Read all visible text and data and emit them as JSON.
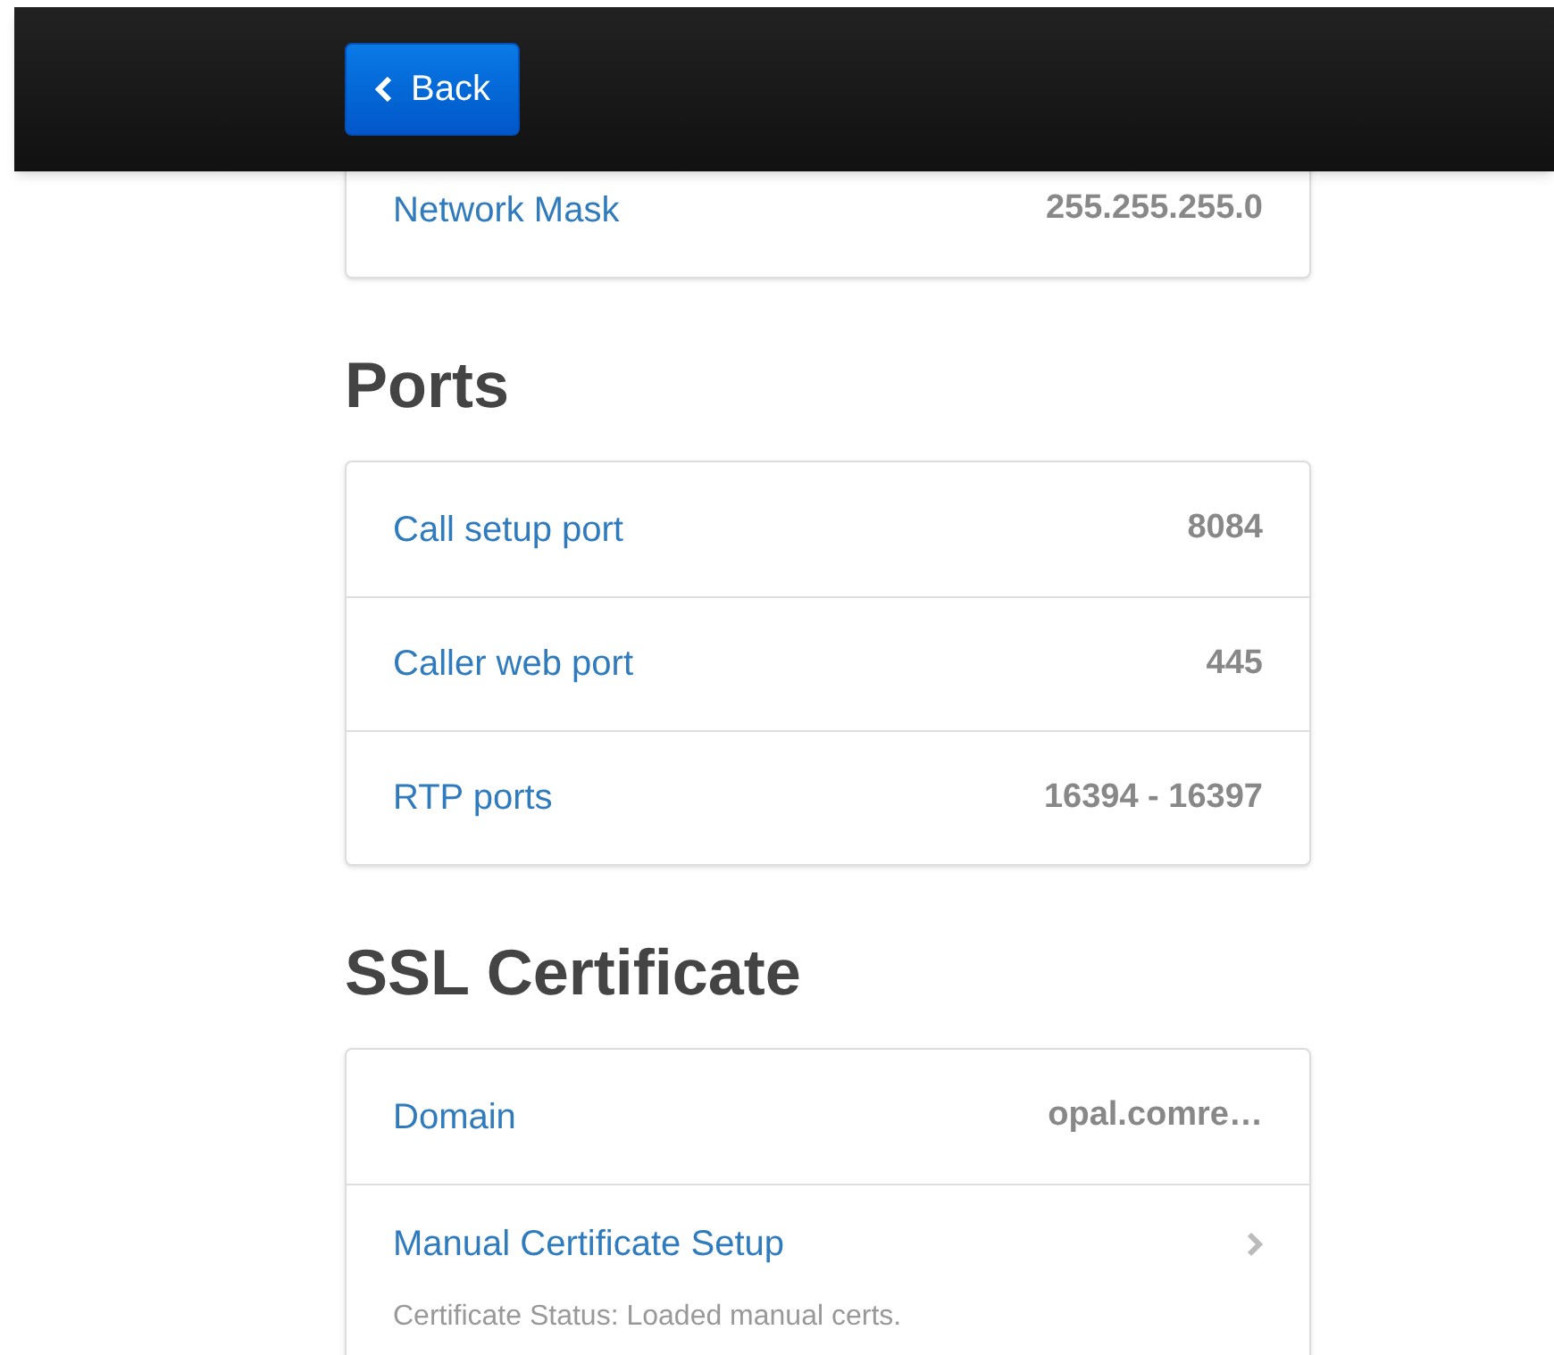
{
  "header": {
    "back_button": "Back"
  },
  "sections": [
    {
      "rows": [
        {
          "kind": "value",
          "label": "Network Mask",
          "value": "255.255.255.0"
        }
      ]
    },
    {
      "heading": "Ports",
      "rows": [
        {
          "kind": "value",
          "label": "Call setup port",
          "value": "8084"
        },
        {
          "kind": "value",
          "label": "Caller web port",
          "value": "445"
        },
        {
          "kind": "value",
          "label": "RTP ports",
          "value": "16394 - 16397"
        }
      ]
    },
    {
      "heading": "SSL Certificate",
      "rows": [
        {
          "kind": "value",
          "label": "Domain",
          "value": "opal.comre…"
        },
        {
          "kind": "link",
          "label": "Manual Certificate Setup",
          "description": "Certificate Status: Loaded manual certs."
        }
      ]
    }
  ]
}
